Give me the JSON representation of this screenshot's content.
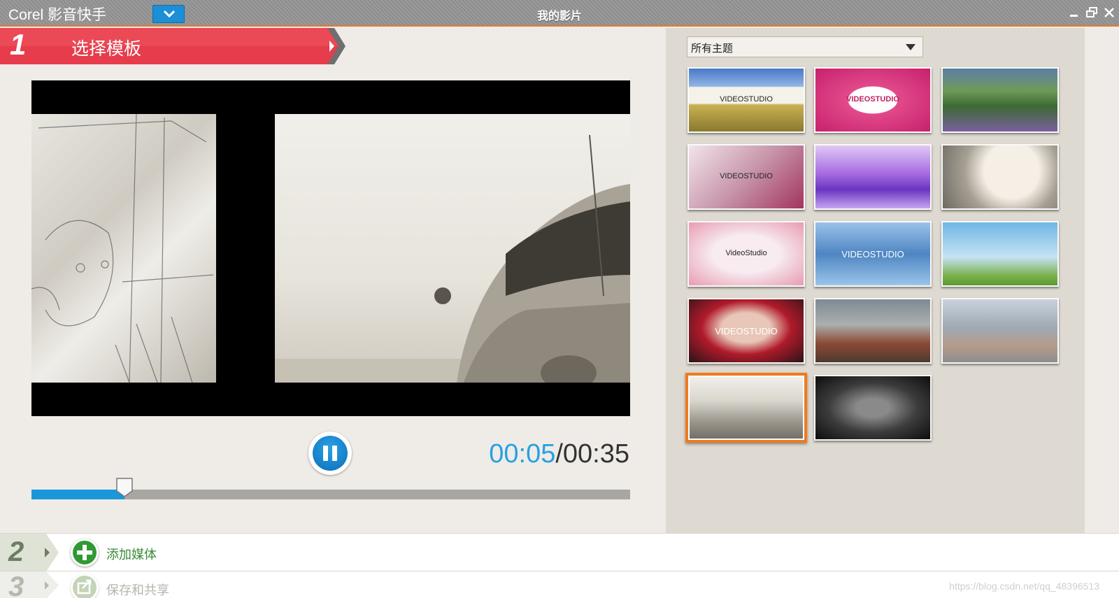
{
  "app": {
    "name": "Corel 影音快手",
    "window_title": "我的影片"
  },
  "step1": {
    "number": "1",
    "title": "选择模板"
  },
  "player": {
    "current_time": "00:05",
    "separator": "/",
    "total_time": "00:35",
    "progress_fraction": 0.155
  },
  "themes": {
    "selected_filter": "所有主题",
    "templates": [
      {
        "label": "VIDEOSTUDIO",
        "style": "wheat-field"
      },
      {
        "label": "VIDEOSTUDIO",
        "style": "birthday"
      },
      {
        "label": "",
        "style": "landscape-collage"
      },
      {
        "label": "VIDEOSTUDIO",
        "style": "wedding"
      },
      {
        "label": "",
        "style": "purple-tiles"
      },
      {
        "label": "",
        "style": "family-frame"
      },
      {
        "label": "VideoStudio",
        "style": "pink-roses"
      },
      {
        "label": "VIDEOSTUDIO",
        "style": "blue-mosaic"
      },
      {
        "label": "",
        "style": "mother-daughter"
      },
      {
        "label": "VIDEOSTUDIO",
        "style": "red-stage"
      },
      {
        "label": "",
        "style": "van-color"
      },
      {
        "label": "",
        "style": "van-faded"
      },
      {
        "label": "",
        "style": "van-sepia-selected"
      },
      {
        "label": "",
        "style": "van-dark"
      }
    ]
  },
  "step2": {
    "number": "2",
    "label": "添加媒体"
  },
  "step3": {
    "number": "3",
    "label": "保存和共享"
  },
  "watermark": "https://blog.csdn.net/qq_48396513"
}
